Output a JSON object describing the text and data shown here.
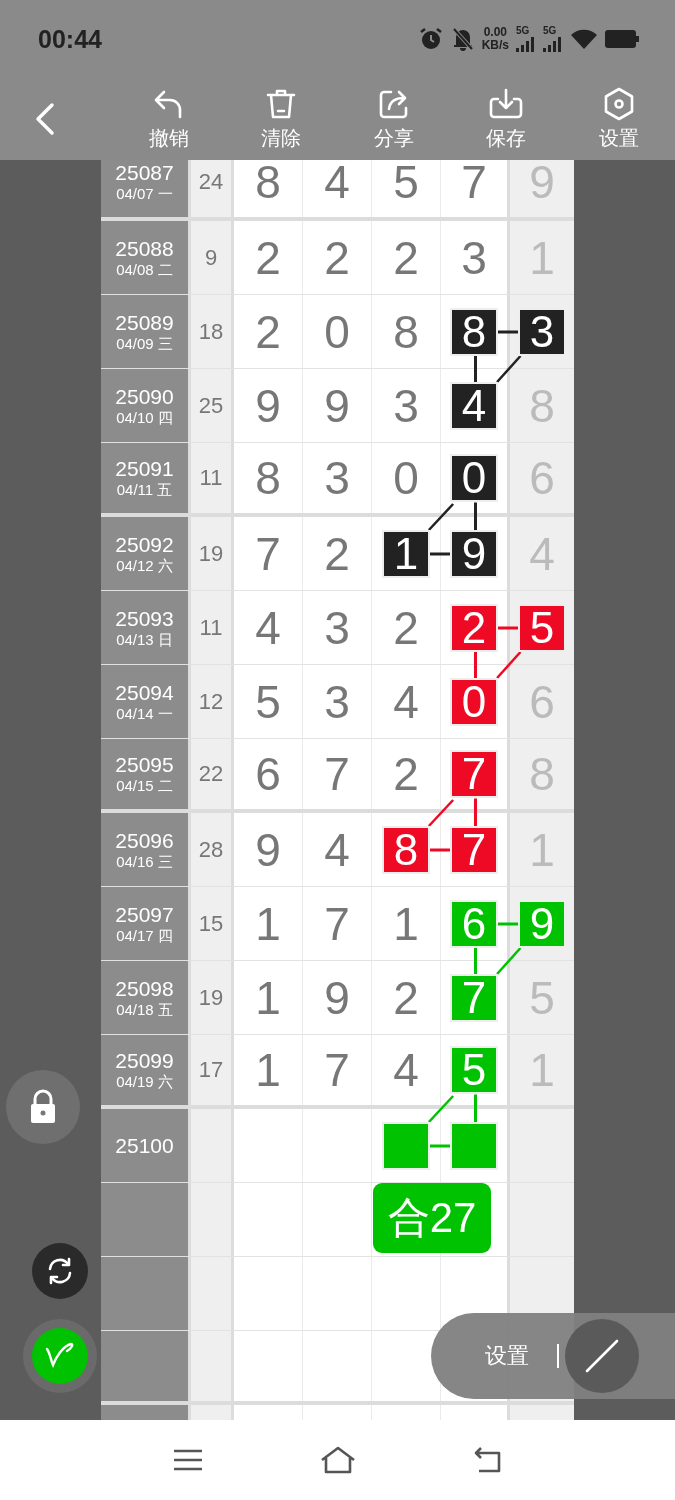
{
  "status_bar": {
    "time": "00:44",
    "speed": "0.00",
    "speed_unit": "KB/s",
    "network_labels": [
      "5G",
      "5G"
    ]
  },
  "toolbar": {
    "actions": [
      "撤销",
      "清除",
      "分享",
      "保存",
      "设置"
    ]
  },
  "rows": [
    {
      "period": "25087",
      "date": "04/07 一",
      "sum": "24",
      "cells": [
        {
          "text": "8"
        },
        {
          "text": "4"
        },
        {
          "text": "5"
        },
        {
          "text": "7"
        },
        {
          "text": "9"
        }
      ]
    },
    {
      "period": "25088",
      "date": "04/08 二",
      "sum": "9",
      "cells": [
        {
          "text": "2"
        },
        {
          "text": "2"
        },
        {
          "text": "2"
        },
        {
          "text": "3"
        },
        {
          "text": "1"
        }
      ]
    },
    {
      "period": "25089",
      "date": "04/09 三",
      "sum": "18",
      "cells": [
        {
          "text": "2"
        },
        {
          "text": "0"
        },
        {
          "text": "8"
        },
        {
          "text": "8",
          "color": "#222222",
          "link_right": true,
          "link_down": true
        },
        {
          "text": "3",
          "color": "#222222",
          "link_down_left": true
        }
      ]
    },
    {
      "period": "25090",
      "date": "04/10 四",
      "sum": "25",
      "cells": [
        {
          "text": "9"
        },
        {
          "text": "9"
        },
        {
          "text": "3"
        },
        {
          "text": "4",
          "color": "#222222"
        },
        {
          "text": "8"
        }
      ]
    },
    {
      "period": "25091",
      "date": "04/11 五",
      "sum": "11",
      "cells": [
        {
          "text": "8"
        },
        {
          "text": "3"
        },
        {
          "text": "0"
        },
        {
          "text": "0",
          "color": "#222222",
          "link_down": true,
          "link_down_left": true
        },
        {
          "text": "6"
        }
      ]
    },
    {
      "period": "25092",
      "date": "04/12 六",
      "sum": "19",
      "cells": [
        {
          "text": "7"
        },
        {
          "text": "2"
        },
        {
          "text": "1",
          "color": "#222222",
          "link_right": true
        },
        {
          "text": "9",
          "color": "#222222"
        },
        {
          "text": "4"
        }
      ]
    },
    {
      "period": "25093",
      "date": "04/13 日",
      "sum": "11",
      "cells": [
        {
          "text": "4"
        },
        {
          "text": "3"
        },
        {
          "text": "2"
        },
        {
          "text": "2",
          "color": "#ee0a24",
          "link_right": true,
          "link_down": true
        },
        {
          "text": "5",
          "color": "#ee0a24",
          "link_down_left": true
        }
      ]
    },
    {
      "period": "25094",
      "date": "04/14 一",
      "sum": "12",
      "cells": [
        {
          "text": "5"
        },
        {
          "text": "3"
        },
        {
          "text": "4"
        },
        {
          "text": "0",
          "color": "#ee0a24"
        },
        {
          "text": "6"
        }
      ]
    },
    {
      "period": "25095",
      "date": "04/15 二",
      "sum": "22",
      "cells": [
        {
          "text": "6"
        },
        {
          "text": "7"
        },
        {
          "text": "2"
        },
        {
          "text": "7",
          "color": "#ee0a24",
          "link_down": true,
          "link_down_left": true
        },
        {
          "text": "8"
        }
      ]
    },
    {
      "period": "25096",
      "date": "04/16 三",
      "sum": "28",
      "cells": [
        {
          "text": "9"
        },
        {
          "text": "4"
        },
        {
          "text": "8",
          "color": "#ee0a24",
          "link_right": true
        },
        {
          "text": "7",
          "color": "#ee0a24"
        },
        {
          "text": "1"
        }
      ]
    },
    {
      "period": "25097",
      "date": "04/17 四",
      "sum": "15",
      "cells": [
        {
          "text": "1"
        },
        {
          "text": "7"
        },
        {
          "text": "1"
        },
        {
          "text": "6",
          "color": "#00c200",
          "link_right": true,
          "link_down": true
        },
        {
          "text": "9",
          "color": "#00c200",
          "link_down_left": true
        }
      ]
    },
    {
      "period": "25098",
      "date": "04/18 五",
      "sum": "19",
      "cells": [
        {
          "text": "1"
        },
        {
          "text": "9"
        },
        {
          "text": "2"
        },
        {
          "text": "7",
          "color": "#00c200"
        },
        {
          "text": "5"
        }
      ]
    },
    {
      "period": "25099",
      "date": "04/19 六",
      "sum": "17",
      "cells": [
        {
          "text": "1"
        },
        {
          "text": "7"
        },
        {
          "text": "4"
        },
        {
          "text": "5",
          "color": "#00c200",
          "link_down": true,
          "link_down_left": true
        },
        {
          "text": "1"
        }
      ]
    },
    {
      "period": "25100",
      "cells": [
        null,
        null,
        {
          "color": "#00c200",
          "link_right": true
        },
        {
          "color": "#00c200"
        },
        null
      ]
    }
  ],
  "total_badge": "合27",
  "float_panel": {
    "label": "设置"
  }
}
